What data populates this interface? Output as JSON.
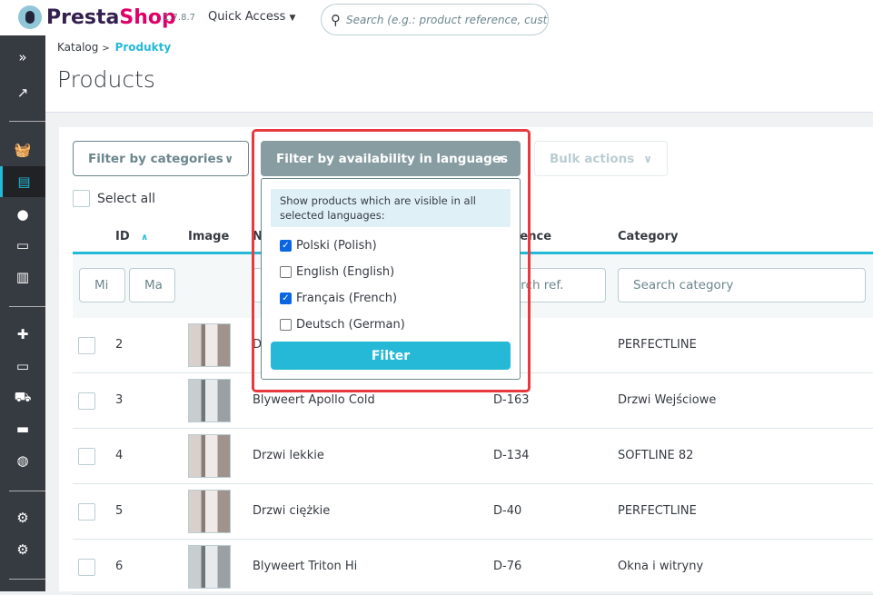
{
  "header": {
    "brand_a": "Presta",
    "brand_b": "Shop",
    "version": "1.7.8.7",
    "quick_access": "Quick Access",
    "search_placeholder": "Search (e.g.: product reference, custon"
  },
  "breadcrumb": {
    "parent": "Katalog",
    "sep": ">",
    "current": "Produkty"
  },
  "page_title": "Products",
  "sidebar": {
    "icons": [
      "expand-icon",
      "dashboard-icon",
      "orders-icon",
      "catalog-icon",
      "customers-icon",
      "messages-icon",
      "stats-icon",
      "modules-icon",
      "design-icon",
      "shipping-icon",
      "payment-icon",
      "international-icon",
      "settings-icon",
      "advanced-settings-icon"
    ],
    "active": "catalog-icon"
  },
  "toolbar": {
    "filter_categories": "Filter by categories",
    "filter_languages": "Filter by availability in languages",
    "bulk_actions": "Bulk actions",
    "select_all": "Select all"
  },
  "dropdown": {
    "info": "Show products which are visible in all selected languages:",
    "languages": [
      {
        "label": "Polski (Polish)",
        "checked": true
      },
      {
        "label": "English (English)",
        "checked": false
      },
      {
        "label": "Français (French)",
        "checked": true
      },
      {
        "label": "Deutsch (German)",
        "checked": false
      }
    ],
    "filter_button": "Filter"
  },
  "table": {
    "columns": {
      "id": "ID",
      "image": "Image",
      "name": "N",
      "reference": "rence",
      "category": "Category"
    },
    "filters": {
      "min": "Mi",
      "max": "Ma",
      "ref": "arch ref.",
      "category": "Search category"
    },
    "rows": [
      {
        "id": "2",
        "name": "D",
        "reference": "",
        "category": "PERFECTLINE"
      },
      {
        "id": "3",
        "name": "Blyweert Apollo Cold",
        "reference": "D-163",
        "category": "Drzwi Wejściowe"
      },
      {
        "id": "4",
        "name": "Drzwi lekkie",
        "reference": "D-134",
        "category": "SOFTLINE 82"
      },
      {
        "id": "5",
        "name": "Drzwi ciężkie",
        "reference": "D-40",
        "category": "PERFECTLINE"
      },
      {
        "id": "6",
        "name": "Blyweert Triton Hi",
        "reference": "D-76",
        "category": "Okna i witryny"
      }
    ]
  },
  "colors": {
    "accent": "#25b9d7",
    "sidebar": "#363a41",
    "highlight": "#e8393e",
    "brand": "#df0067"
  }
}
